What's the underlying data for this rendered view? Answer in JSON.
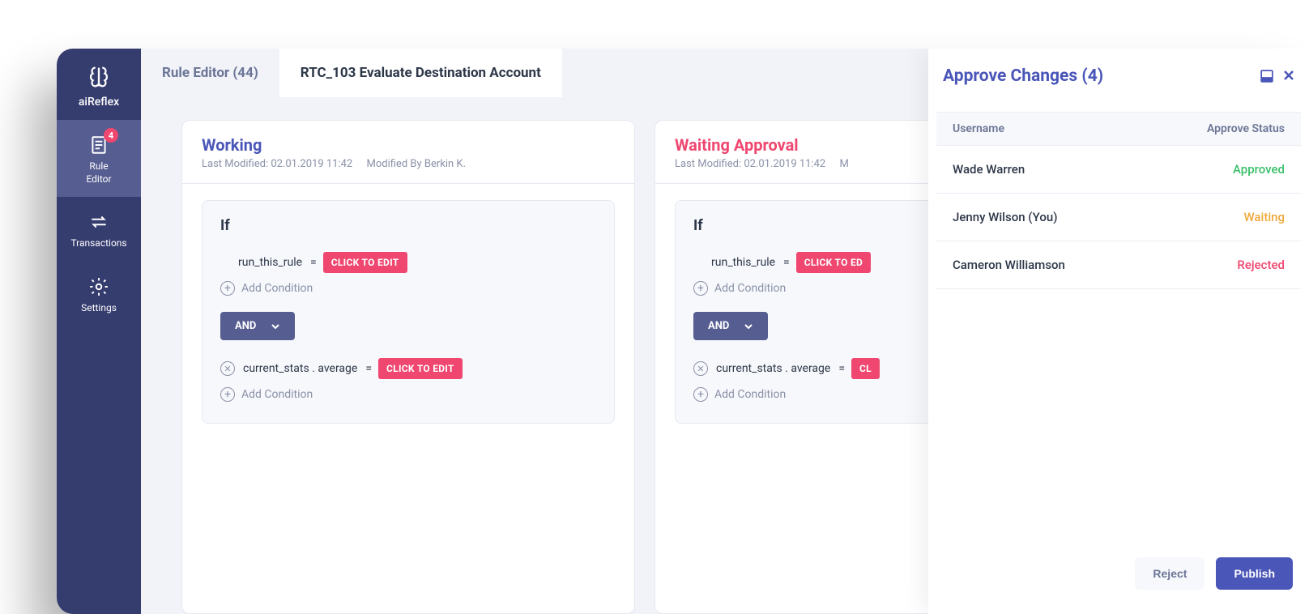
{
  "sidebar": {
    "logo_label": "aiReflex",
    "items": [
      {
        "label": "Rule\nEditor",
        "badge": "4"
      },
      {
        "label": "Transactions"
      },
      {
        "label": "Settings"
      }
    ]
  },
  "tabs": [
    {
      "label": "Rule Editor (44)"
    },
    {
      "label": "RTC_103 Evaluate Destination Account"
    }
  ],
  "rule_cards": [
    {
      "title": "Working",
      "last_modified_label": "Last Modified: 02.01.2019  11:42",
      "modified_by_label": "Modified By Berkin K.",
      "if_label": "If",
      "cond1_var": "run_this_rule",
      "cond1_op": "=",
      "click_to_edit": "CLICK TO EDIT",
      "add_condition": "Add Condition",
      "logic_op": "AND",
      "cond2_expr": "current_stats . average",
      "cond2_op": "="
    },
    {
      "title": "Waiting Approval",
      "last_modified_label": "Last Modified: 02.01.2019  11:42",
      "modified_by_label": "M",
      "if_label": "If",
      "cond1_var": "run_this_rule",
      "cond1_op": "=",
      "click_to_edit": "CLICK TO ED",
      "add_condition": "Add Condition",
      "logic_op": "AND",
      "cond2_expr": "current_stats . average",
      "cond2_op": "=",
      "click_to_edit2": "CL"
    }
  ],
  "approve_panel": {
    "title": "Approve Changes (4)",
    "col_username": "Username",
    "col_status": "Approve Status",
    "rows": [
      {
        "name": "Wade Warren",
        "status": "Approved",
        "status_class": "approved"
      },
      {
        "name": "Jenny Wilson (You)",
        "status": "Waiting",
        "status_class": "waiting"
      },
      {
        "name": "Cameron Williamson",
        "status": "Rejected",
        "status_class": "rejected"
      }
    ],
    "reject_label": "Reject",
    "publish_label": "Publish"
  }
}
